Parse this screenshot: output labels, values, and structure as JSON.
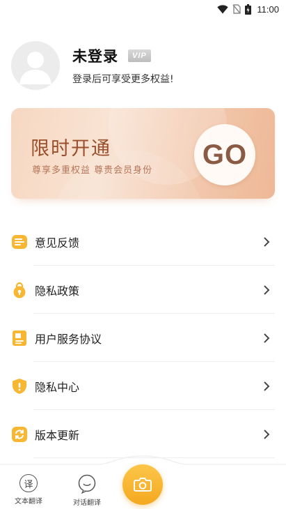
{
  "status_bar": {
    "time": "11:00"
  },
  "profile": {
    "username": "未登录",
    "vip_badge": "VIP",
    "login_tip": "登录后可享受更多权益!"
  },
  "promo": {
    "title": "限时开通",
    "subtitle": "尊享多重权益 尊贵会员身份",
    "go_label": "GO"
  },
  "menu": {
    "items": [
      {
        "label": "意见反馈",
        "icon": "feedback-icon"
      },
      {
        "label": "隐私政策",
        "icon": "privacy-lock-icon"
      },
      {
        "label": "用户服务协议",
        "icon": "agreement-icon"
      },
      {
        "label": "隐私中心",
        "icon": "shield-icon"
      },
      {
        "label": "版本更新",
        "icon": "update-icon"
      }
    ]
  },
  "bottom_nav": {
    "items": [
      {
        "label": "文本翻译",
        "icon_glyph": "译"
      },
      {
        "label": "对话翻译",
        "icon": "chat-icon"
      }
    ],
    "camera_icon": "camera-icon"
  },
  "colors": {
    "accent": "#f6ae2a",
    "promo_text": "#9a4f2c",
    "go_text": "#8a5a44"
  }
}
